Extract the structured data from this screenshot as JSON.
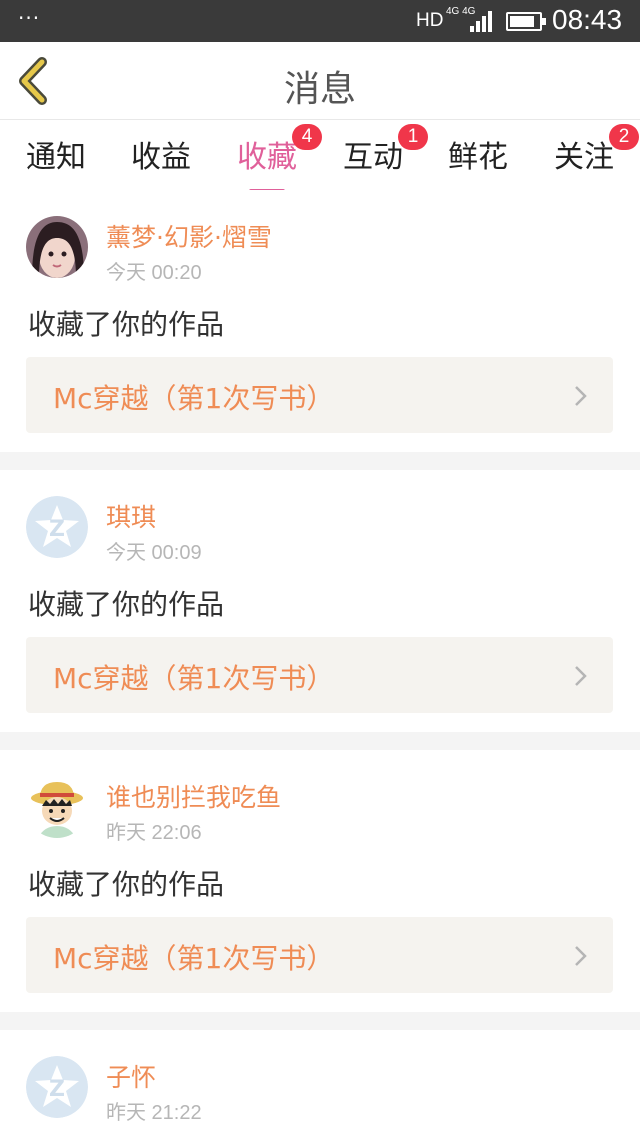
{
  "status_bar": {
    "dots": "···",
    "hd": "HD",
    "network": "4G 4G",
    "time": "08:43",
    "battery_level": 0.85,
    "signal_bars": 4
  },
  "header": {
    "title": "消息",
    "back_icon": "chevron-left-icon",
    "accent_color": "#e6c84a"
  },
  "tabs": [
    {
      "label": "通知",
      "badge": ""
    },
    {
      "label": "收益",
      "badge": ""
    },
    {
      "label": "收藏",
      "badge": "4",
      "active": true
    },
    {
      "label": "互动",
      "badge": "1"
    },
    {
      "label": "鲜花",
      "badge": ""
    },
    {
      "label": "关注",
      "badge": "2"
    }
  ],
  "colors": {
    "active_tab": "#e0609a",
    "username": "#ef8c55",
    "badge": "#f0364a",
    "card_link_bg": "#f5f3ef"
  },
  "messages": [
    {
      "username": "薰梦·幻影·熠雪",
      "time": "今天 00:20",
      "action": "收藏了你的作品",
      "work_title": "Mc穿越（第1次写书）",
      "avatar": "photo-avatar"
    },
    {
      "username": "琪琪",
      "time": "今天 00:09",
      "action": "收藏了你的作品",
      "work_title": "Mc穿越（第1次写书）",
      "avatar": "default-q-avatar"
    },
    {
      "username": "谁也别拦我吃鱼",
      "time": "昨天 22:06",
      "action": "收藏了你的作品",
      "work_title": "Mc穿越（第1次写书）",
      "avatar": "cartoon-avatar"
    },
    {
      "username": "子怀",
      "time": "昨天 21:22",
      "action": "",
      "work_title": "",
      "avatar": "default-q-avatar"
    }
  ]
}
